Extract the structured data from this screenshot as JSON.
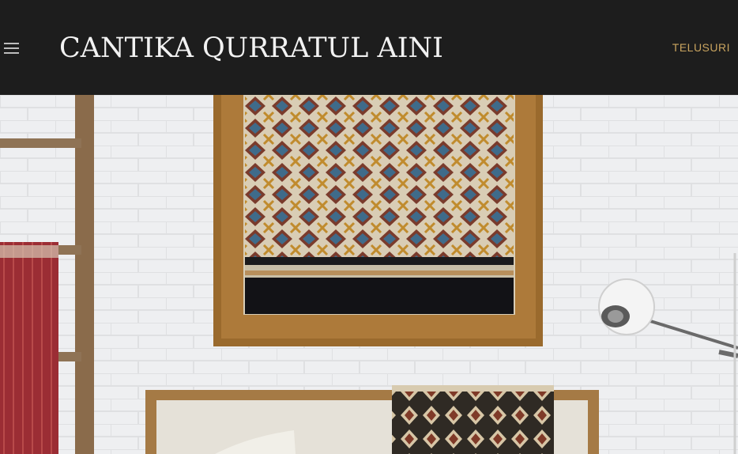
{
  "header": {
    "menu_icon": "hamburger-menu-icon",
    "site_title": "CANTIKA QURRATUL AINI",
    "explore_label": "TELUSURI",
    "colors": {
      "background": "#1d1d1d",
      "title": "#f2f2f2",
      "accent": "#c9a45f"
    }
  },
  "hero": {
    "image": "interior-textile-wall-photo"
  }
}
